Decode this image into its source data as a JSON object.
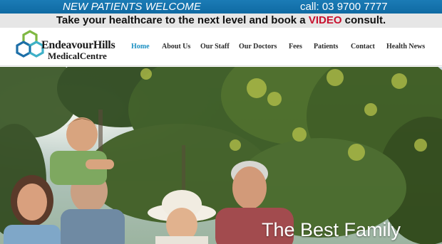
{
  "topbar": {
    "welcome": "NEW PATIENTS WELCOME",
    "call": "call: 03 9700 7777"
  },
  "promo": {
    "before": "Take your healthcare to the next level and book a ",
    "highlight": "VIDEO",
    "after": " consult."
  },
  "logo": {
    "line1": "EndeavourHills",
    "line2": "MedicalCentre"
  },
  "nav": {
    "items": [
      {
        "label": "Home"
      },
      {
        "label": "About Us"
      },
      {
        "label": "Our Staff"
      },
      {
        "label": "Our Doctors"
      },
      {
        "label": "Fees"
      },
      {
        "label": "Patients"
      },
      {
        "label": "Contact"
      },
      {
        "label": "Health News"
      }
    ]
  },
  "hero": {
    "caption": "The Best Family"
  },
  "colors": {
    "topbar": "#0f6aa3",
    "accent": "#1a8fc2",
    "promo_highlight": "#c8102e",
    "logo_green": "#7fb842",
    "logo_blue": "#1d6fa8",
    "logo_teal": "#3eb1c8"
  }
}
